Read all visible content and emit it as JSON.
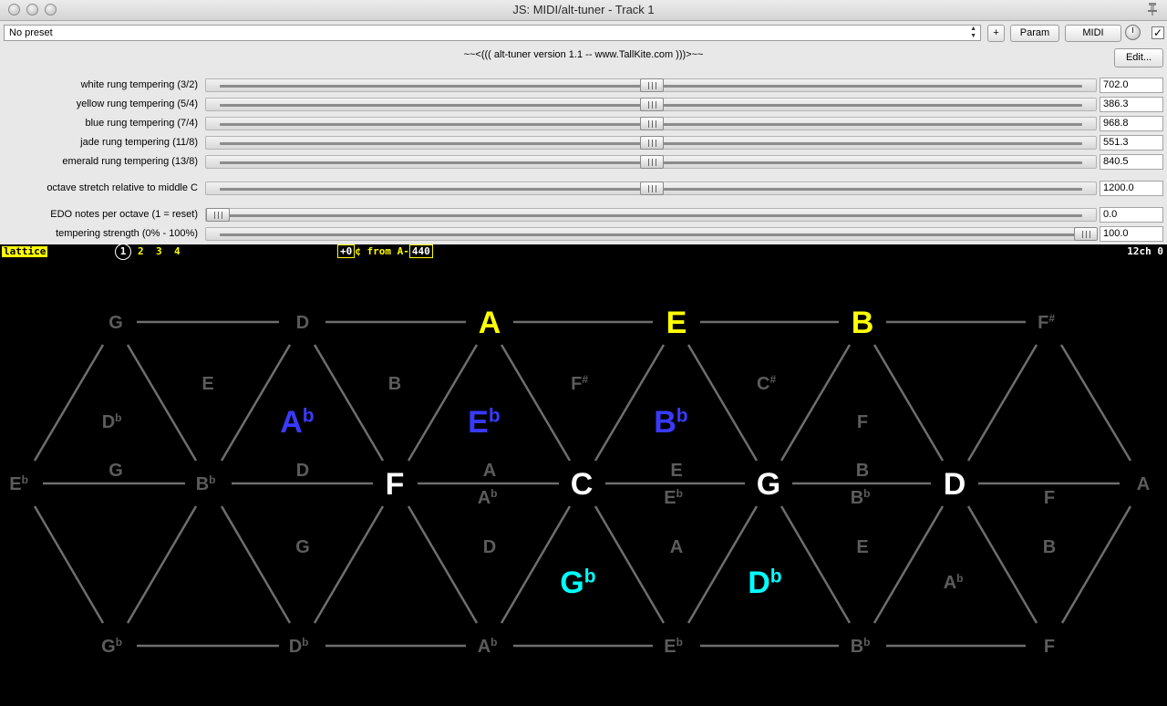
{
  "window": {
    "title": "JS: MIDI/alt-tuner - Track 1"
  },
  "toolbar": {
    "preset_value": "No preset",
    "add_label": "+",
    "param_label": "Param",
    "midi_label": "MIDI",
    "edit_label": "Edit...",
    "checkbox_mark": "✓"
  },
  "header": {
    "version_text": "~~<(((   alt-tuner version 1.1 -- www.TallKite.com   )))>~~"
  },
  "params": [
    {
      "label": "white rung tempering (3/2)",
      "value": "702.0",
      "fraction": 0.5
    },
    {
      "label": "yellow rung tempering (5/4)",
      "value": "386.3",
      "fraction": 0.5
    },
    {
      "label": "blue rung tempering (7/4)",
      "value": "968.8",
      "fraction": 0.5
    },
    {
      "label": "jade rung tempering (11/8)",
      "value": "551.3",
      "fraction": 0.5
    },
    {
      "label": "emerald rung tempering (13/8)",
      "value": "840.5",
      "fraction": 0.5
    },
    {
      "label": "octave stretch relative to middle C",
      "value": "1200.0",
      "fraction": 0.5
    },
    {
      "label": "EDO notes per octave (1 = reset)",
      "value": "0.0",
      "fraction": 0.0
    },
    {
      "label": "tempering strength (0% - 100%)",
      "value": "100.0",
      "fraction": 1.0
    }
  ],
  "status": {
    "mode": "lattice",
    "pages": [
      "1",
      "2",
      "3",
      "4"
    ],
    "active_page": "1",
    "offset_value": "+0",
    "offset_unit": "¢ from A-",
    "ref_freq": "440",
    "channels": "12ch 0"
  },
  "colors": {
    "yellow": "#ffff00",
    "white": "#ffffff",
    "blue": "#3a3aff",
    "cyan": "#00ffff",
    "gray": "#5c5c5c",
    "line": "#6e6e6e"
  },
  "lattice": {
    "notes": [
      {
        "n": "G",
        "acc": "",
        "c": "gray",
        "s": 20
      },
      {
        "n": "D",
        "acc": "",
        "c": "gray",
        "s": 20
      },
      {
        "n": "A",
        "acc": "",
        "c": "yellow",
        "s": 34
      },
      {
        "n": "E",
        "acc": "",
        "c": "yellow",
        "s": 34
      },
      {
        "n": "B",
        "acc": "",
        "c": "yellow",
        "s": 34
      },
      {
        "n": "F",
        "acc": "#",
        "c": "gray",
        "s": 20
      },
      {
        "n": "E",
        "acc": "",
        "c": "gray",
        "s": 20
      },
      {
        "n": "B",
        "acc": "",
        "c": "gray",
        "s": 20
      },
      {
        "n": "F",
        "acc": "#",
        "c": "gray",
        "s": 20
      },
      {
        "n": "C",
        "acc": "#",
        "c": "gray",
        "s": 20
      },
      {
        "n": "D",
        "acc": "b",
        "c": "gray",
        "s": 20
      },
      {
        "n": "A",
        "acc": "b",
        "c": "blue",
        "s": 34
      },
      {
        "n": "E",
        "acc": "b",
        "c": "blue",
        "s": 34
      },
      {
        "n": "B",
        "acc": "b",
        "c": "blue",
        "s": 34
      },
      {
        "n": "F",
        "acc": "",
        "c": "gray",
        "s": 20
      },
      {
        "n": "G",
        "acc": "",
        "c": "gray",
        "s": 20
      },
      {
        "n": "D",
        "acc": "",
        "c": "gray",
        "s": 20
      },
      {
        "n": "A",
        "acc": "",
        "c": "gray",
        "s": 20
      },
      {
        "n": "E",
        "acc": "",
        "c": "gray",
        "s": 20
      },
      {
        "n": "B",
        "acc": "",
        "c": "gray",
        "s": 20
      },
      {
        "n": "E",
        "acc": "b",
        "c": "gray",
        "s": 20
      },
      {
        "n": "B",
        "acc": "b",
        "c": "gray",
        "s": 20
      },
      {
        "n": "F",
        "acc": "",
        "c": "white",
        "s": 34
      },
      {
        "n": "C",
        "acc": "",
        "c": "white",
        "s": 34
      },
      {
        "n": "G",
        "acc": "",
        "c": "white",
        "s": 34
      },
      {
        "n": "D",
        "acc": "",
        "c": "white",
        "s": 34
      },
      {
        "n": "A",
        "acc": "",
        "c": "gray",
        "s": 20
      },
      {
        "n": "A",
        "acc": "b",
        "c": "gray",
        "s": 20
      },
      {
        "n": "E",
        "acc": "b",
        "c": "gray",
        "s": 20
      },
      {
        "n": "B",
        "acc": "b",
        "c": "gray",
        "s": 20
      },
      {
        "n": "F",
        "acc": "",
        "c": "gray",
        "s": 20
      },
      {
        "n": "G",
        "acc": "",
        "c": "gray",
        "s": 20
      },
      {
        "n": "D",
        "acc": "",
        "c": "gray",
        "s": 20
      },
      {
        "n": "A",
        "acc": "",
        "c": "gray",
        "s": 20
      },
      {
        "n": "E",
        "acc": "",
        "c": "gray",
        "s": 20
      },
      {
        "n": "B",
        "acc": "",
        "c": "gray",
        "s": 20
      },
      {
        "n": "G",
        "acc": "b",
        "c": "cyan",
        "s": 34
      },
      {
        "n": "D",
        "acc": "b",
        "c": "cyan",
        "s": 34
      },
      {
        "n": "A",
        "acc": "b",
        "c": "gray",
        "s": 20
      },
      {
        "n": "G",
        "acc": "b",
        "c": "gray",
        "s": 20
      },
      {
        "n": "D",
        "acc": "b",
        "c": "gray",
        "s": 20
      },
      {
        "n": "A",
        "acc": "b",
        "c": "gray",
        "s": 20
      },
      {
        "n": "E",
        "acc": "b",
        "c": "gray",
        "s": 20
      },
      {
        "n": "B",
        "acc": "b",
        "c": "gray",
        "s": 20
      },
      {
        "n": "F",
        "acc": "",
        "c": "gray",
        "s": 20
      }
    ]
  }
}
